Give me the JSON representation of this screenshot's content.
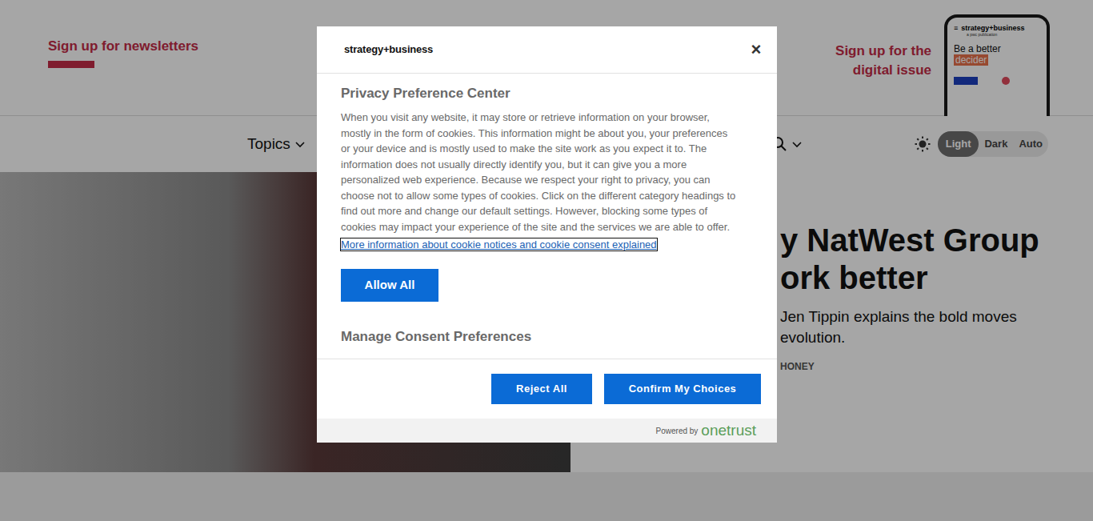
{
  "header": {
    "newsletter_link": "Sign up for newsletters",
    "digital_issue_link": "Sign up for the digital issue",
    "phone_preview": {
      "brand": "strategy+business",
      "publisher": "a pwc publication",
      "headline_line1": "Be a better",
      "headline_line2": "decider",
      "menu": "≡"
    }
  },
  "nav": {
    "items": [
      {
        "label": "Topics",
        "expanded": false
      }
    ],
    "theme_options": [
      {
        "label": "Light",
        "selected": true
      },
      {
        "label": "Dark",
        "selected": false
      },
      {
        "label": "Auto",
        "selected": false
      }
    ]
  },
  "hero": {
    "headline_lines": [
      "y NatWest Group",
      "ork better"
    ],
    "dek_lines": [
      "Jen Tippin explains the bold moves",
      "evolution."
    ],
    "byline": "HONEY"
  },
  "modal": {
    "logo": "strategy+business",
    "close": "×",
    "title": "Privacy Preference Center",
    "body": "When you visit any website, it may store or retrieve information on your browser, mostly in the form of cookies. This information might be about you, your preferences or your device and is mostly used to make the site work as you expect it to. The information does not usually directly identify you, but it can give you a more personalized web experience. Because we respect your right to privacy, you can choose not to allow some types of cookies. Click on the different category headings to find out more and change our default settings. However, blocking some types of cookies may impact your experience of the site and the services we are able to offer.",
    "link": "More information about cookie notices and cookie consent explained",
    "link_focused": true,
    "allow_button": "Allow All",
    "section_title": "Manage Consent Preferences",
    "reject_button": "Reject All",
    "confirm_button": "Confirm My Choices",
    "powered_by": "Powered by",
    "powered_brand": "onetrust"
  }
}
